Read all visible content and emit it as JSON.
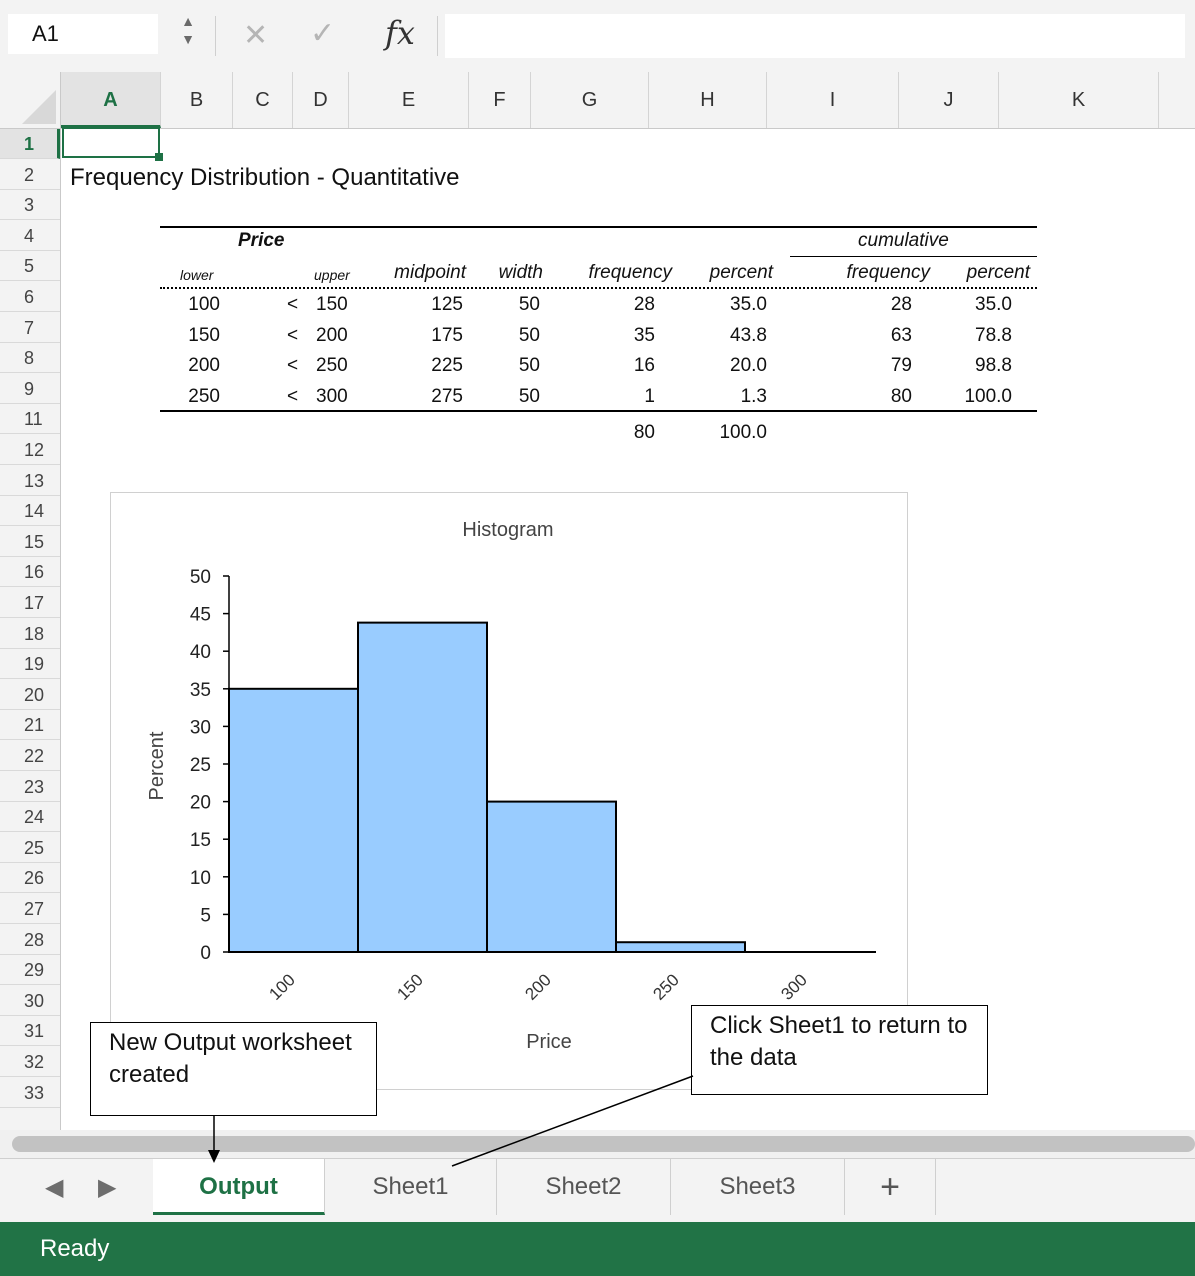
{
  "formula_bar": {
    "name_box": "A1",
    "stepper_icon": "up-down-stepper-icon",
    "cancel_icon": "✕",
    "enter_icon": "✓",
    "fx_label": "fx",
    "formula": ""
  },
  "grid": {
    "columns": [
      "A",
      "B",
      "C",
      "D",
      "E",
      "F",
      "G",
      "H",
      "I",
      "J",
      "K"
    ],
    "active_column": "A",
    "rows": [
      "1",
      "2",
      "3",
      "4",
      "5",
      "6",
      "7",
      "8",
      "9",
      "11",
      "12",
      "13",
      "14",
      "15",
      "16",
      "17",
      "18",
      "19",
      "20",
      "21",
      "22",
      "23",
      "24",
      "25",
      "26",
      "27",
      "28",
      "29",
      "30",
      "31",
      "32",
      "33"
    ],
    "active_row": "1",
    "selected_cell": "A1",
    "colors": {
      "accent": "#1e7145",
      "status_bar": "#217346",
      "bar_fill": "#99ccff"
    }
  },
  "sheet": {
    "title": "Frequency Distribution - Quantitative",
    "table": {
      "group_price": "Price",
      "group_cumulative": "cumulative",
      "headers": {
        "lower": "lower",
        "upper": "upper",
        "midpoint": "midpoint",
        "width": "width",
        "frequency": "frequency",
        "percent": "percent",
        "cum_frequency": "frequency",
        "cum_percent": "percent"
      },
      "rows": [
        {
          "lower": "100",
          "lt": "<",
          "upper": "150",
          "midpoint": "125",
          "width": "50",
          "frequency": "28",
          "percent": "35.0",
          "cum_frequency": "28",
          "cum_percent": "35.0"
        },
        {
          "lower": "150",
          "lt": "<",
          "upper": "200",
          "midpoint": "175",
          "width": "50",
          "frequency": "35",
          "percent": "43.8",
          "cum_frequency": "63",
          "cum_percent": "78.8"
        },
        {
          "lower": "200",
          "lt": "<",
          "upper": "250",
          "midpoint": "225",
          "width": "50",
          "frequency": "16",
          "percent": "20.0",
          "cum_frequency": "79",
          "cum_percent": "98.8"
        },
        {
          "lower": "250",
          "lt": "<",
          "upper": "300",
          "midpoint": "275",
          "width": "50",
          "frequency": "1",
          "percent": "1.3",
          "cum_frequency": "80",
          "cum_percent": "100.0"
        }
      ],
      "totals": {
        "frequency": "80",
        "percent": "100.0"
      }
    }
  },
  "chart_data": {
    "type": "bar",
    "title": "Histogram",
    "xlabel": "Price",
    "ylabel": "Percent",
    "categories": [
      "100",
      "150",
      "200",
      "250",
      "300"
    ],
    "bins": [
      [
        100,
        150
      ],
      [
        150,
        200
      ],
      [
        200,
        250
      ],
      [
        250,
        300
      ]
    ],
    "values": [
      35.0,
      43.8,
      20.0,
      1.3
    ],
    "ylim": [
      0,
      50
    ],
    "yticks": [
      0,
      5,
      10,
      15,
      20,
      25,
      30,
      35,
      40,
      45,
      50
    ],
    "grid": false,
    "legend": "none"
  },
  "callouts": {
    "output_note": "New Output worksheet created",
    "sheet1_note": "Click Sheet1 to return to the data"
  },
  "tabs": {
    "prev_icon": "◀",
    "next_icon": "▶",
    "items": [
      "Output",
      "Sheet1",
      "Sheet2",
      "Sheet3"
    ],
    "active": "Output",
    "add_icon": "+"
  },
  "status": {
    "text": "Ready"
  }
}
